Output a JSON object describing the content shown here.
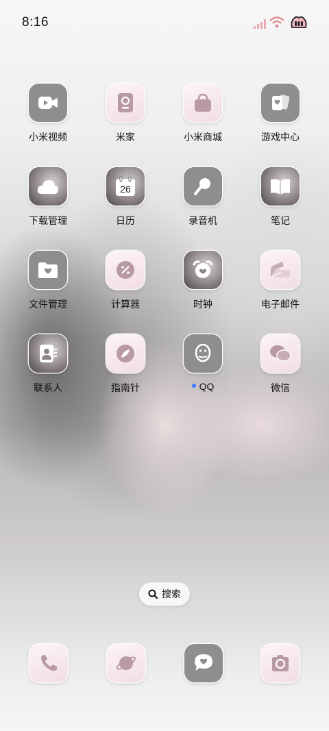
{
  "status_bar": {
    "time": "8:16",
    "icons": [
      "signal-icon",
      "wifi-icon",
      "battery-icon"
    ]
  },
  "apps": [
    {
      "label": "小米视频",
      "icon": "video-camera-icon"
    },
    {
      "label": "米家",
      "icon": "mijia-device-icon"
    },
    {
      "label": "小米商城",
      "icon": "shopping-bag-icon"
    },
    {
      "label": "游戏中心",
      "icon": "game-cards-icon"
    },
    {
      "label": "下载管理",
      "icon": "cloud-download-icon"
    },
    {
      "label": "日历",
      "icon": "calendar-icon",
      "badge_text": "26"
    },
    {
      "label": "录音机",
      "icon": "microphone-icon"
    },
    {
      "label": "笔记",
      "icon": "notebook-icon"
    },
    {
      "label": "文件管理",
      "icon": "folder-heart-icon"
    },
    {
      "label": "计算器",
      "icon": "calculator-icon"
    },
    {
      "label": "时钟",
      "icon": "alarm-clock-icon"
    },
    {
      "label": "电子邮件",
      "icon": "email-icon"
    },
    {
      "label": "联系人",
      "icon": "contacts-card-icon"
    },
    {
      "label": "指南针",
      "icon": "compass-icon"
    },
    {
      "label": "QQ",
      "icon": "qq-penguin-icon",
      "new_indicator": true
    },
    {
      "label": "微信",
      "icon": "wechat-bubbles-icon"
    }
  ],
  "search": {
    "label": "搜索",
    "icon": "search-icon"
  },
  "dock": [
    {
      "name": "phone",
      "icon": "phone-icon"
    },
    {
      "name": "browser",
      "icon": "planet-icon"
    },
    {
      "name": "messages",
      "icon": "message-heart-icon"
    },
    {
      "name": "camera",
      "icon": "camera-icon"
    }
  ],
  "colors": {
    "tile_gray": "#8e8e8e",
    "tile_pink": "#f1dde3",
    "status_accent": "#e08a95",
    "qq_dot": "#3a7bff"
  }
}
